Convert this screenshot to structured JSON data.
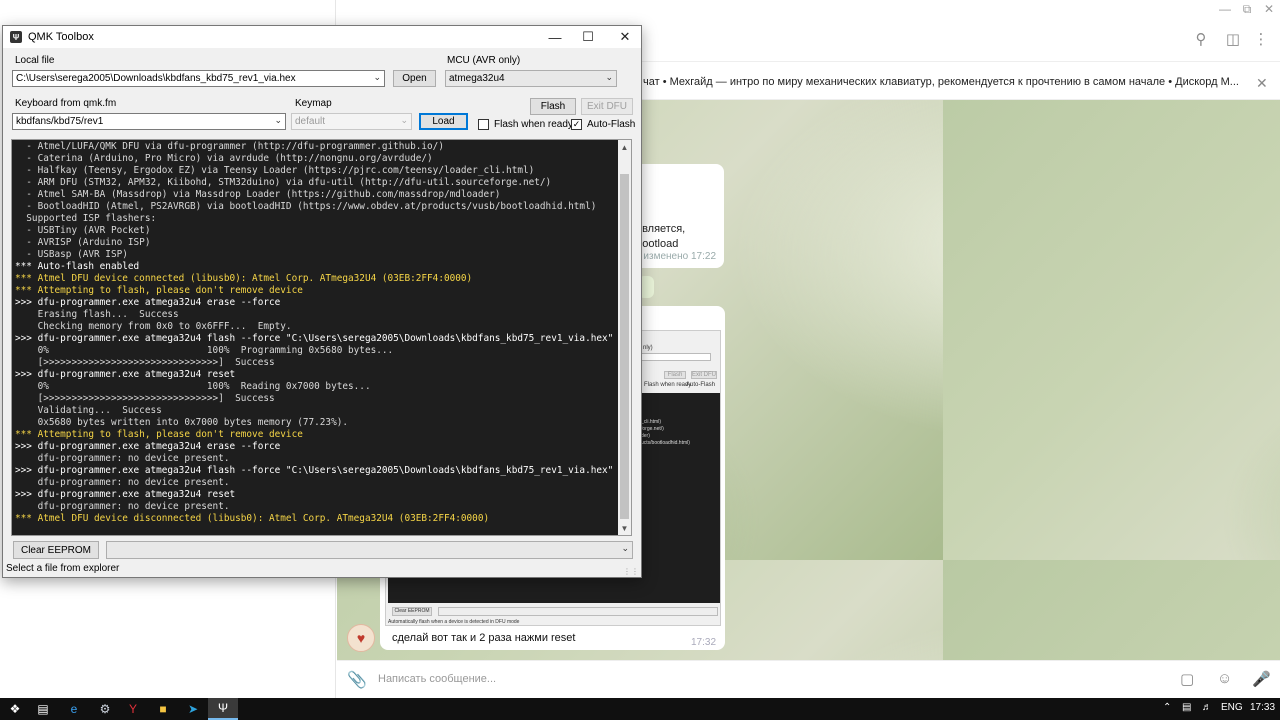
{
  "telegram": {
    "pinned_text": "чат • Мехгайд — интро по миру механических клавиатур, рекомендуется к прочтению в самом начале  • Дискорд М...",
    "bubble1_lines": [
      "оявляется,",
      "ı bootload"
    ],
    "bubble1_time": "изменено 17:22",
    "screenshot_rows": [
      "nly)",
      "",
      "Flash when ready",
      "Auto-Flash",
      "Clear EEPROM",
      "Automatically flash when a device is detected in DFU mode"
    ],
    "screenshot_term": [
      "_cli.html)",
      "forge.net/)",
      "der)",
      "ucts/bootloadhid.html)"
    ],
    "screenshot_btns": [
      "Flash",
      "Exit DFU"
    ],
    "message_text": "сделай вот так и 2 раза нажми reset",
    "message_time": "17:32",
    "input_placeholder": "Написать сообщение..."
  },
  "qmk": {
    "title": "QMK Toolbox",
    "local_file_label": "Local file",
    "local_file_value": "C:\\Users\\serega2005\\Downloads\\kbdfans_kbd75_rev1_via.hex",
    "open_label": "Open",
    "mcu_label": "MCU (AVR only)",
    "mcu_value": "atmega32u4",
    "keyboard_label": "Keyboard from qmk.fm",
    "keyboard_value": "kbdfans/kbd75/rev1",
    "keymap_label": "Keymap",
    "keymap_value": "default",
    "load_label": "Load",
    "flash_label": "Flash",
    "exit_dfu_label": "Exit DFU",
    "flash_when_ready_label": "Flash when ready",
    "flash_when_ready_checked": false,
    "auto_flash_label": "Auto-Flash",
    "auto_flash_checked": true,
    "clear_eeprom_label": "Clear EEPROM",
    "status_text": "Select a file from explorer",
    "console_lines": [
      {
        "type": "info",
        "text": "  - Atmel/LUFA/QMK DFU via dfu-programmer (http://dfu-programmer.github.io/)"
      },
      {
        "type": "info",
        "text": "  - Caterina (Arduino, Pro Micro) via avrdude (http://nongnu.org/avrdude/)"
      },
      {
        "type": "info",
        "text": "  - Halfkay (Teensy, Ergodox EZ) via Teensy Loader (https://pjrc.com/teensy/loader_cli.html)"
      },
      {
        "type": "info",
        "text": "  - ARM DFU (STM32, APM32, Kiibohd, STM32duino) via dfu-util (http://dfu-util.sourceforge.net/)"
      },
      {
        "type": "info",
        "text": "  - Atmel SAM-BA (Massdrop) via Massdrop Loader (https://github.com/massdrop/mdloader)"
      },
      {
        "type": "info",
        "text": "  - BootloadHID (Atmel, PS2AVRGB) via bootloadHID (https://www.obdev.at/products/vusb/bootloadhid.html)"
      },
      {
        "type": "info",
        "text": "  Supported ISP flashers:"
      },
      {
        "type": "info",
        "text": "  - USBTiny (AVR Pocket)"
      },
      {
        "type": "info",
        "text": "  - AVRISP (Arduino ISP)"
      },
      {
        "type": "info",
        "text": "  - USBasp (AVR ISP)"
      },
      {
        "type": "cmd",
        "text": "*** Auto-flash enabled"
      },
      {
        "type": "hl",
        "text": "*** Atmel DFU device connected (libusb0): Atmel Corp. ATmega32U4 (03EB:2FF4:0000)"
      },
      {
        "type": "hl",
        "text": "*** Attempting to flash, please don't remove device"
      },
      {
        "type": "cmd",
        "text": ">>> dfu-programmer.exe atmega32u4 erase --force"
      },
      {
        "type": "info",
        "text": "    Erasing flash...  Success"
      },
      {
        "type": "info",
        "text": "    Checking memory from 0x0 to 0x6FFF...  Empty."
      },
      {
        "type": "cmd",
        "text": ">>> dfu-programmer.exe atmega32u4 flash --force \"C:\\Users\\serega2005\\Downloads\\kbdfans_kbd75_rev1_via.hex\""
      },
      {
        "type": "info",
        "text": "    0%                            100%  Programming 0x5680 bytes..."
      },
      {
        "type": "info",
        "text": "    [>>>>>>>>>>>>>>>>>>>>>>>>>>>>>>>]  Success"
      },
      {
        "type": "cmd",
        "text": ">>> dfu-programmer.exe atmega32u4 reset"
      },
      {
        "type": "info",
        "text": "    0%                            100%  Reading 0x7000 bytes..."
      },
      {
        "type": "info",
        "text": "    [>>>>>>>>>>>>>>>>>>>>>>>>>>>>>>>]  Success"
      },
      {
        "type": "info",
        "text": "    Validating...  Success"
      },
      {
        "type": "info",
        "text": "    0x5680 bytes written into 0x7000 bytes memory (77.23%)."
      },
      {
        "type": "hl",
        "text": "*** Attempting to flash, please don't remove device"
      },
      {
        "type": "cmd",
        "text": ">>> dfu-programmer.exe atmega32u4 erase --force"
      },
      {
        "type": "info",
        "text": "    dfu-programmer: no device present."
      },
      {
        "type": "cmd",
        "text": ">>> dfu-programmer.exe atmega32u4 flash --force \"C:\\Users\\serega2005\\Downloads\\kbdfans_kbd75_rev1_via.hex\""
      },
      {
        "type": "info",
        "text": "    dfu-programmer: no device present."
      },
      {
        "type": "cmd",
        "text": ">>> dfu-programmer.exe atmega32u4 reset"
      },
      {
        "type": "info",
        "text": "    dfu-programmer: no device present."
      },
      {
        "type": "hl",
        "text": "*** Atmel DFU device disconnected (libusb0): Atmel Corp. ATmega32U4 (03EB:2FF4:0000)"
      }
    ]
  },
  "taskbar": {
    "language": "ENG",
    "time": "17:33",
    "icons": [
      "windows-start",
      "task-view",
      "edge",
      "steam",
      "yandex-browser",
      "file-explorer",
      "telegram",
      "qmk-toolbox"
    ]
  },
  "colors": {
    "console_bg": "#1e1e1e",
    "console_info": "#d8d8d8",
    "console_highlight": "#f5d547",
    "accent": "#0078d7"
  }
}
